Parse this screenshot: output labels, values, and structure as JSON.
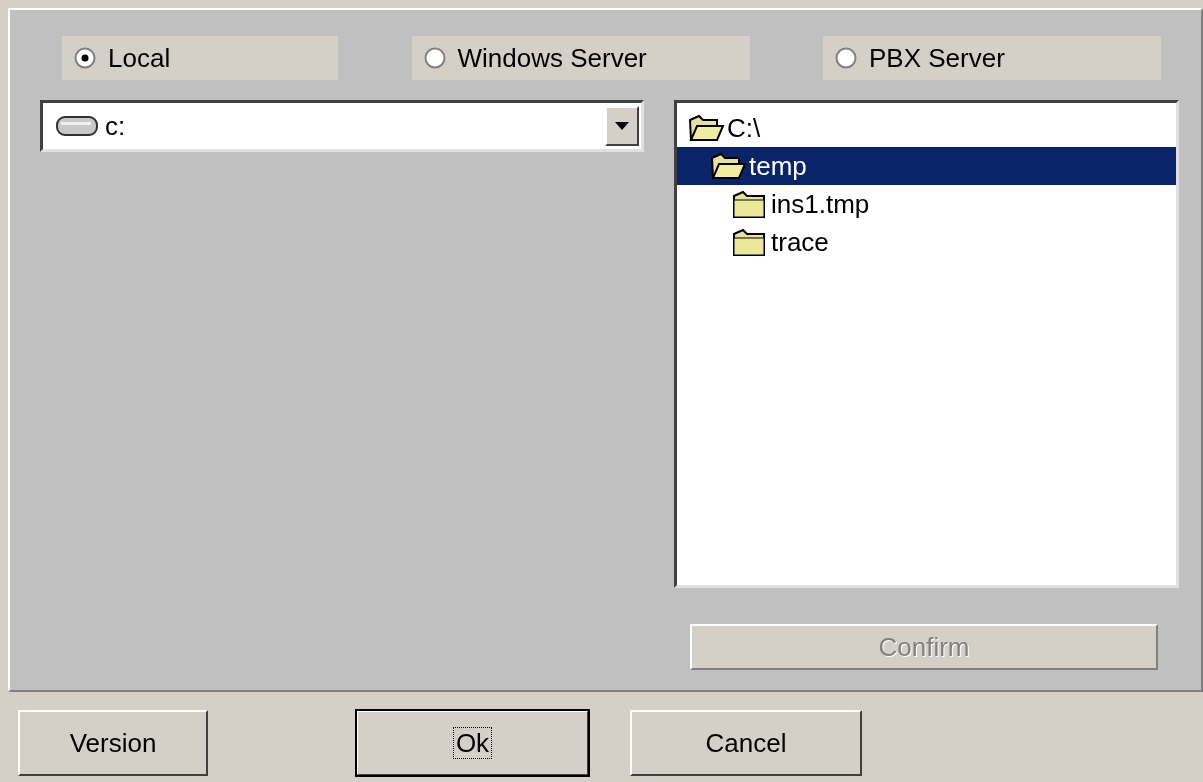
{
  "sources": [
    {
      "label": "Local",
      "selected": true
    },
    {
      "label": "Windows Server",
      "selected": false
    },
    {
      "label": "PBX Server",
      "selected": false
    }
  ],
  "drive": {
    "value": "c:"
  },
  "tree": [
    {
      "label": "C:\\",
      "expanded": true,
      "selected": false,
      "children": [
        {
          "label": "temp",
          "expanded": true,
          "selected": true,
          "children": [
            {
              "label": "ins1.tmp",
              "expanded": false,
              "selected": false
            },
            {
              "label": "trace",
              "expanded": false,
              "selected": false
            }
          ]
        }
      ]
    }
  ],
  "confirm": {
    "label": "Confirm",
    "disabled": true
  },
  "buttons": [
    {
      "label": "Version",
      "default": false
    },
    {
      "label": "Ok",
      "default": true
    },
    {
      "label": "Cancel",
      "default": false
    }
  ]
}
